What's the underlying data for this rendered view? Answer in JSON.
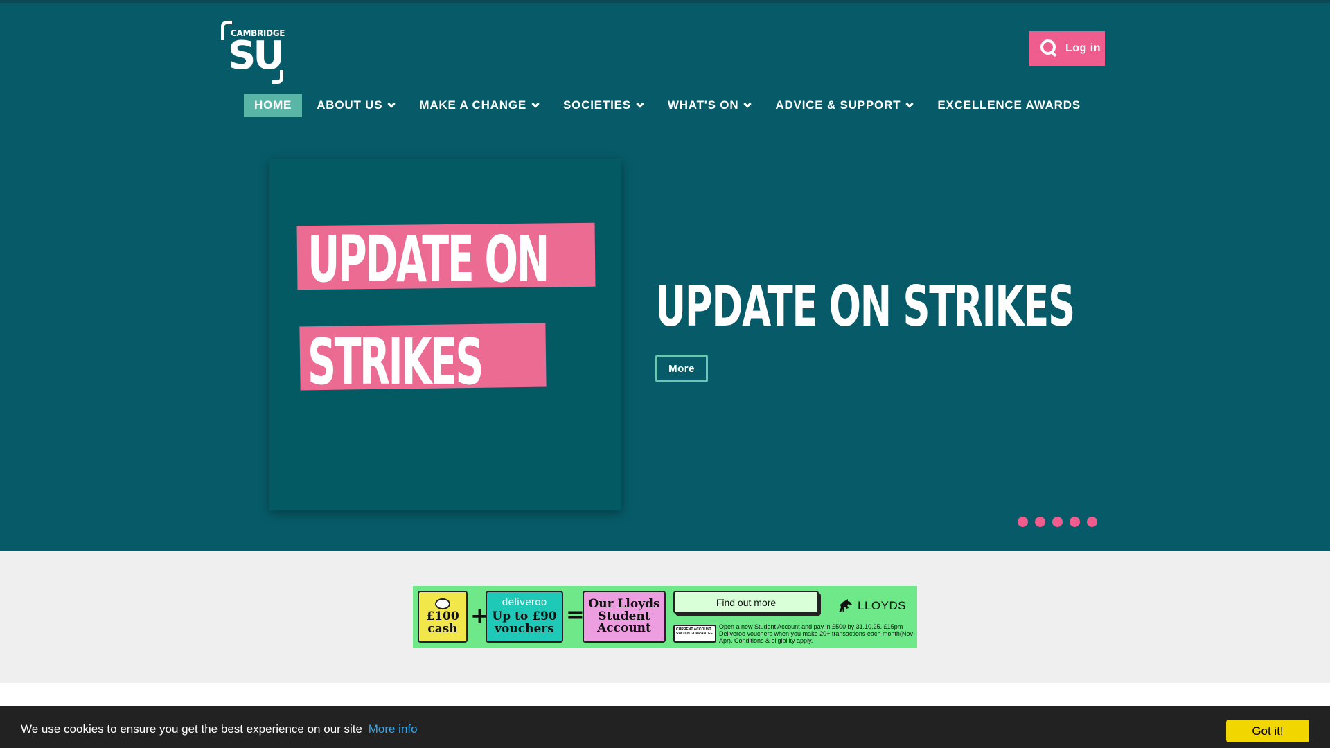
{
  "logo": {
    "small_text": "CAMBRIDGE",
    "big_text": "SU"
  },
  "header": {
    "login_label": "Log in",
    "search_icon": "search-icon"
  },
  "nav": {
    "items": [
      {
        "label": "HOME",
        "active": true,
        "dropdown": false
      },
      {
        "label": "ABOUT US",
        "active": false,
        "dropdown": true
      },
      {
        "label": "MAKE A CHANGE",
        "active": false,
        "dropdown": true
      },
      {
        "label": "SOCIETIES",
        "active": false,
        "dropdown": true
      },
      {
        "label": "WHAT'S ON",
        "active": false,
        "dropdown": true
      },
      {
        "label": "ADVICE & SUPPORT",
        "active": false,
        "dropdown": true
      },
      {
        "label": "EXCELLENCE AWARDS",
        "active": false,
        "dropdown": false
      }
    ]
  },
  "hero": {
    "image_line1": "UPDATE ON",
    "image_line2": "STRIKES",
    "title": "UPDATE ON STRIKES",
    "more_label": "More",
    "slide_count": 5
  },
  "ad": {
    "box1": "£100 cash",
    "box2_brand": "deliveroo",
    "box2": "Up to £90 vouchers",
    "box3": "Our Lloyds Student Account",
    "cta": "Find out more",
    "switch_line1": "CURRENT ACCOUNT",
    "switch_line2": "SWITCH GUARANTEE",
    "small_print": "Open a new Student Account and pay in £500 by 31.10.25. £15pm Deliveroo vouchers when you make 20+ transactions each month(Nov-Apr). Conditions & eligibility apply.",
    "brand": "LLOYDS"
  },
  "cookie": {
    "text": "We use cookies to ensure you get the best experience on our site",
    "link": "More info",
    "button": "Got it!"
  },
  "colors": {
    "header_bg": "#075b68",
    "accent_pink": "#ef5d8e",
    "active_nav": "#59b5a6",
    "cookie_button": "#f1d600"
  }
}
